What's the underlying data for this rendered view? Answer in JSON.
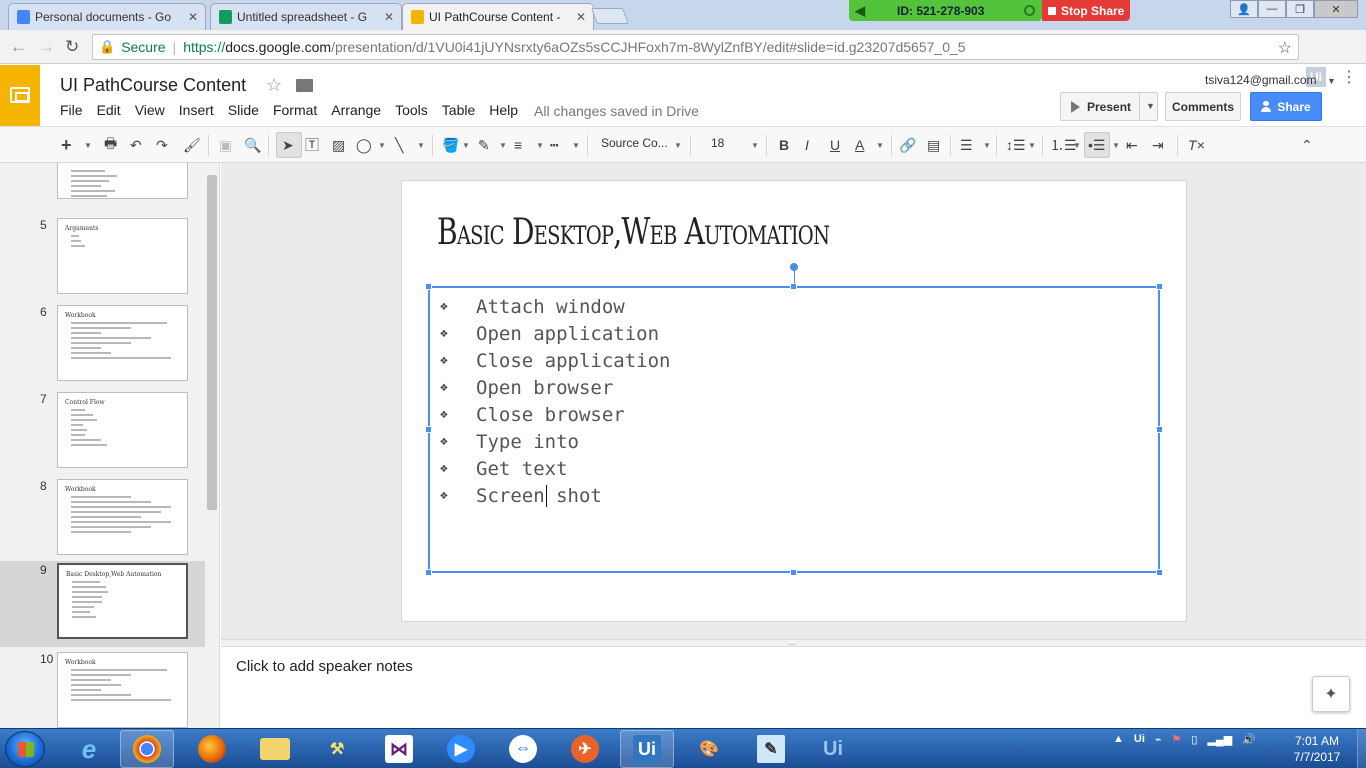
{
  "browser": {
    "tabs": [
      {
        "title": "Personal documents - Go",
        "favicon_color": "#4285f4"
      },
      {
        "title": "Untitled spreadsheet - G",
        "favicon_color": "#0f9d58"
      },
      {
        "title": "UI PathCourse Content -",
        "favicon_color": "#f4b400",
        "active": true
      }
    ],
    "share_id": "ID: 521-278-903",
    "stop_share": "Stop Share",
    "secure_label": "Secure",
    "url_scheme": "https://",
    "url_host": "docs.google.com",
    "url_path": "/presentation/d/1VU0i41jUYNsrxty6aOZs5sCCJHFoxh7m-8WylZnfBY/edit#slide=id.g23207d5657_0_5",
    "extension_label": "Ui"
  },
  "app": {
    "doc_title": "UI PathCourse Content",
    "menu": [
      "File",
      "Edit",
      "View",
      "Insert",
      "Slide",
      "Format",
      "Arrange",
      "Tools",
      "Table",
      "Help"
    ],
    "saved_status": "All changes saved in Drive",
    "account": "tsiva124@gmail.com",
    "present_label": "Present",
    "comments_label": "Comments",
    "share_label": "Share",
    "accent_color": "#f4b400"
  },
  "toolbar": {
    "font_name": "Source Co...",
    "font_size": "18"
  },
  "filmstrip": {
    "slides": [
      {
        "number": "",
        "title": ""
      },
      {
        "number": "5",
        "title": "Arguments"
      },
      {
        "number": "6",
        "title": "Workbook"
      },
      {
        "number": "7",
        "title": "Control Flow"
      },
      {
        "number": "8",
        "title": "Workbook"
      },
      {
        "number": "9",
        "title": "Basic Desktop,Web Automation",
        "selected": true
      },
      {
        "number": "10",
        "title": "Workbook"
      }
    ]
  },
  "slide": {
    "title": "Basic Desktop,Web Automation",
    "bullets": [
      "Attach window",
      "Open application",
      "Close application",
      "Open browser",
      "Close browser",
      "Type into",
      "Get text",
      "Screen shot"
    ],
    "bullet_glyph": "❖"
  },
  "notes": {
    "placeholder": "Click to add speaker notes"
  },
  "taskbar": {
    "time": "7:01 AM",
    "date": "7/7/2017"
  }
}
